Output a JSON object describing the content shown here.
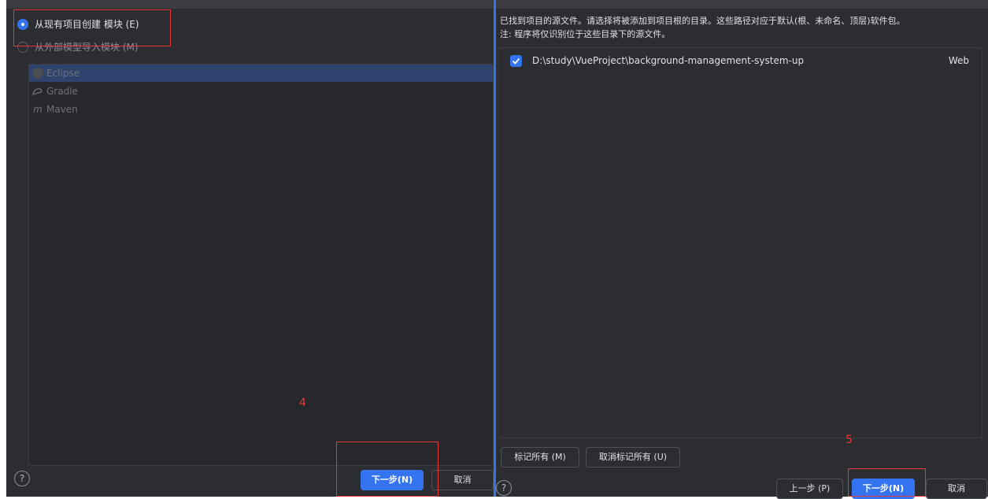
{
  "left": {
    "options": {
      "existing_label": "从现有项目创建 模块 (E)",
      "external_label": "从外部模型导入模块 (M)"
    },
    "models": [
      {
        "label": "Eclipse",
        "icon": "eclipse-icon"
      },
      {
        "label": "Gradle",
        "icon": "gradle-icon"
      },
      {
        "label": "Maven",
        "icon": "maven-icon",
        "glyph": "m"
      }
    ],
    "step_label": "4",
    "help": "?",
    "next_label": "下一步(N)",
    "cancel_label": "取消"
  },
  "right": {
    "description_line1": "已找到项目的源文件。请选择将被添加到项目根的目录。这些路径对应于默认(根、未命名、顶层)软件包。",
    "description_line2": "注: 程序将仅识别位于这些目录下的源文件。",
    "sources": [
      {
        "path": "D:\\study\\VueProject\\background-management-system-up",
        "type": "Web",
        "checked": true
      }
    ],
    "mark_all_label": "标记所有 (M)",
    "unmark_all_label": "取消标记所有 (U)",
    "step_label": "5",
    "help": "?",
    "prev_label": "上一步 (P)",
    "next_label": "下一步(N)",
    "cancel_label": "取消"
  },
  "colors": {
    "background": "#2b2d30",
    "accent": "#3574f0",
    "annotation": "#e5383a",
    "selection": "#2e436e"
  }
}
